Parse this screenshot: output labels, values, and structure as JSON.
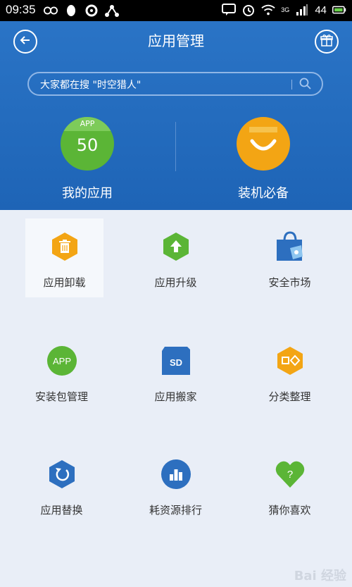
{
  "status_bar": {
    "time": "09:35",
    "network": "3G",
    "battery": "44"
  },
  "header": {
    "title": "应用管理"
  },
  "search": {
    "placeholder": "大家都在搜 \"时空猎人\""
  },
  "featured": [
    {
      "label": "我的应用",
      "badge": "APP",
      "count": "50"
    },
    {
      "label": "装机必备"
    }
  ],
  "grid": [
    {
      "label": "应用卸载",
      "icon": "trash-icon"
    },
    {
      "label": "应用升级",
      "icon": "upgrade-arrow-icon"
    },
    {
      "label": "安全市场",
      "icon": "shopping-bag-icon"
    },
    {
      "label": "安装包管理",
      "icon": "app-package-icon",
      "icon_text": "APP"
    },
    {
      "label": "应用搬家",
      "icon": "sd-card-icon",
      "icon_text": "SD"
    },
    {
      "label": "分类整理",
      "icon": "category-icon"
    },
    {
      "label": "应用替换",
      "icon": "replace-icon"
    },
    {
      "label": "耗资源排行",
      "icon": "ranking-chart-icon"
    },
    {
      "label": "猜你喜欢",
      "icon": "heart-question-icon",
      "icon_text": "?"
    }
  ],
  "watermark": "Bai 经验",
  "colors": {
    "header_blue": "#2a74c6",
    "green": "#5bb536",
    "orange": "#f3a514",
    "icon_blue": "#2d6fbf"
  }
}
